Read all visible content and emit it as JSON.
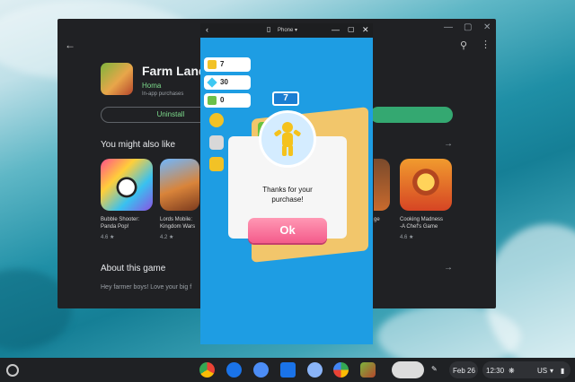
{
  "store": {
    "app_name": "Farm Land -",
    "developer": "Homa",
    "iap_note": "In-app purchases",
    "uninstall_label": "Uninstall",
    "section_title": "You might also like",
    "games": [
      {
        "name": "Bubble Shooter: Panda Pop!",
        "line1": "Bubble Shooter:",
        "line2": "Panda Pop!",
        "rating": "4.6 ★"
      },
      {
        "name": "Lords Mobile: Kingdom Wars",
        "line1": "Lords Mobile:",
        "line2": "Kingdom Wars",
        "rating": "4.2 ★"
      },
      {
        "name": "Cooking Madness -A Chef's Game",
        "line1": "Cooking Madness",
        "line2": "-A Chef's Game",
        "rating": "4.6 ★"
      }
    ],
    "partial_label": "ge",
    "about_title": "About this game",
    "about_body": "Hey farmer boys! Love your big f"
  },
  "game": {
    "window_title": "Phone ▾",
    "coins": "7",
    "gems": "30",
    "cubes": "0",
    "level": "7",
    "dialog_text_1": "Thanks for your",
    "dialog_text_2": "purchase!",
    "ok_label": "Ok"
  },
  "shelf": {
    "date": "Feb 26",
    "time": "12:30",
    "locale": "US"
  },
  "colors": {
    "accent_green": "#34a871",
    "ok_pink": "#f45b8b",
    "game_blue": "#1e9de3"
  }
}
